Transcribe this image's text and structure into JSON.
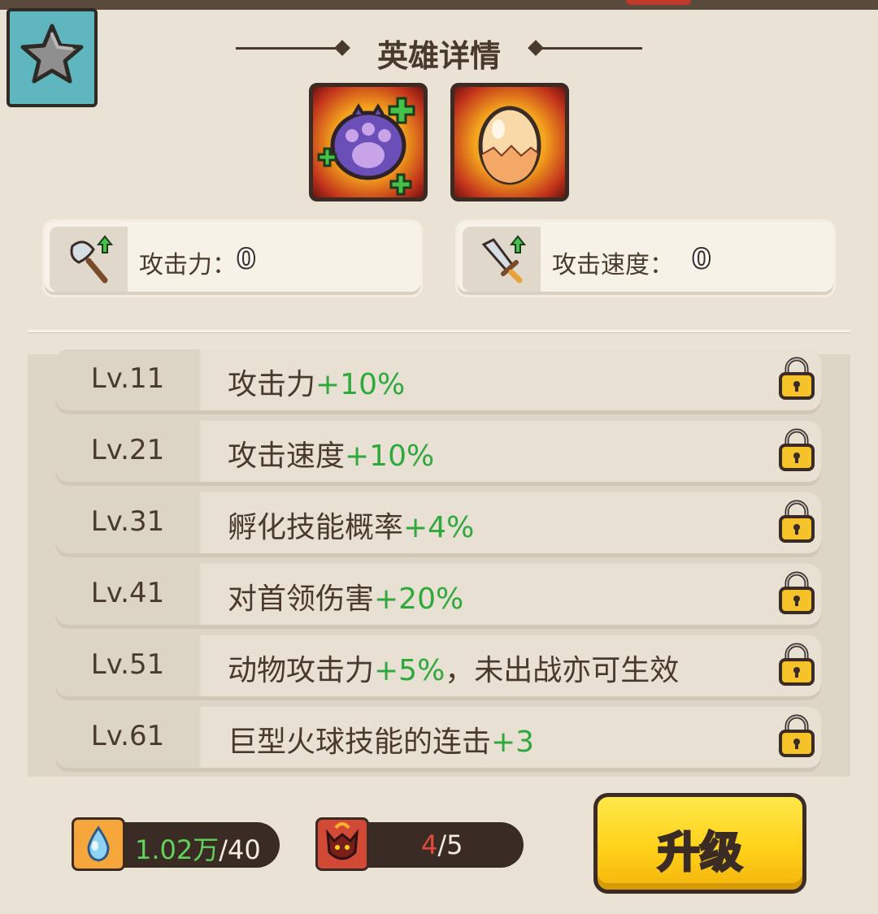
{
  "header": {
    "title": "英雄详情"
  },
  "skills": [
    {
      "icon": "paw-icon"
    },
    {
      "icon": "egg-icon"
    }
  ],
  "stats": [
    {
      "icon": "axe-icon",
      "label": "攻击力：",
      "value": "0"
    },
    {
      "icon": "sword-icon",
      "label": "攻击速度：",
      "value": "0"
    }
  ],
  "levels": [
    {
      "level": "Lv.11",
      "text": "攻击力",
      "bonus": "+10%",
      "suffix": "",
      "locked": true
    },
    {
      "level": "Lv.21",
      "text": "攻击速度",
      "bonus": "+10%",
      "suffix": "",
      "locked": true
    },
    {
      "level": "Lv.31",
      "text": "孵化技能概率",
      "bonus": "+4%",
      "suffix": "",
      "locked": true
    },
    {
      "level": "Lv.41",
      "text": "对首领伤害",
      "bonus": "+20%",
      "suffix": "",
      "locked": true
    },
    {
      "level": "Lv.51",
      "text": "动物攻击力",
      "bonus": "+5%",
      "suffix": "，未出战亦可生效",
      "locked": true
    },
    {
      "level": "Lv.61",
      "text": "巨型火球技能的连击",
      "bonus": "+3",
      "suffix": "",
      "locked": true
    }
  ],
  "currency": {
    "essence": {
      "icon": "essence-potion-icon",
      "have": "1.02万",
      "need": "/40"
    },
    "shards": {
      "icon": "hero-portrait-icon",
      "have": "4",
      "need": "/5"
    }
  },
  "upgrade": {
    "label": "升级"
  },
  "colors": {
    "background": "#e9e2d5",
    "bonus_green": "#2fa83c",
    "button_yellow": "#ffd21a",
    "badge_teal": "#5fb6bf"
  }
}
